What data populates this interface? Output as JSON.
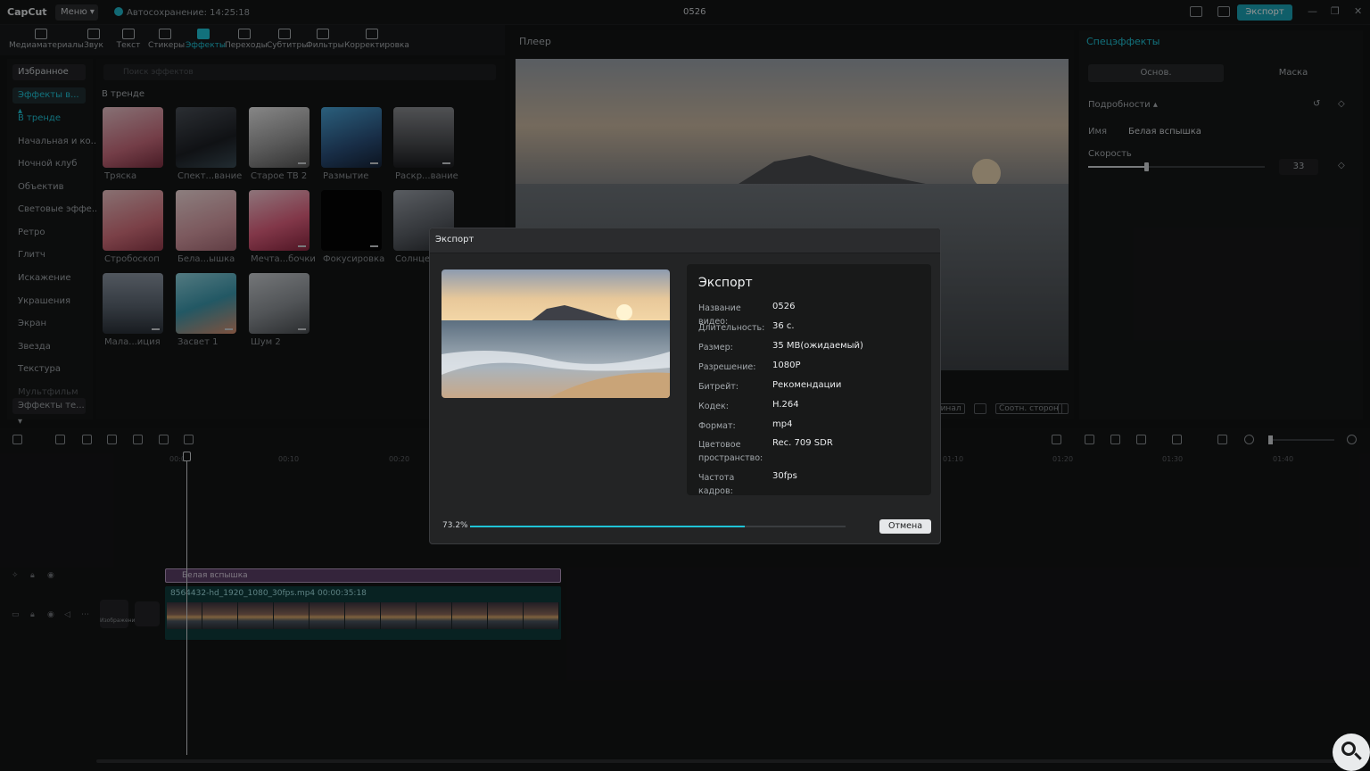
{
  "titlebar": {
    "logo": "CapCut",
    "menu_label": "Меню ▾",
    "autosave": "Автосохранение: 14:25:18",
    "doc_title": "0526",
    "export_label": "Экспорт"
  },
  "toolbar": {
    "tabs": [
      {
        "label": "Медиаматериалы",
        "icon": "media-icon"
      },
      {
        "label": "Звук",
        "icon": "audio-icon"
      },
      {
        "label": "Текст",
        "icon": "text-icon"
      },
      {
        "label": "Стикеры",
        "icon": "sticker-icon"
      },
      {
        "label": "Эффекты",
        "icon": "effects-icon",
        "active": true
      },
      {
        "label": "Переходы",
        "icon": "transition-icon"
      },
      {
        "label": "Субтитры",
        "icon": "subtitles-icon"
      },
      {
        "label": "Фильтры",
        "icon": "filter-icon"
      },
      {
        "label": "Корректировка",
        "icon": "adjust-icon"
      }
    ]
  },
  "categories": {
    "favorites": "Избранное",
    "selected_group": "Эффекты в... ▴",
    "items": [
      "В тренде",
      "Начальная и ко...",
      "Ночной клуб",
      "Объектив",
      "Световые эффе...",
      "Ретро",
      "Глитч",
      "Искажение",
      "Украшения",
      "Экран",
      "Звезда",
      "Текстура",
      "Мультфильм"
    ],
    "bottom_group": "Эффекты те... ▾"
  },
  "effects": {
    "search_placeholder": "Поиск эффектов",
    "section": "В тренде",
    "items": [
      "Тряска",
      "Спект...вание",
      "Старое ТВ 2",
      "Размытие",
      "Раскр...вание",
      "Стробоскоп",
      "Бела...ышка",
      "Мечта...бочки",
      "Фокусировка",
      "Солнце",
      "Мала...иция",
      "Засвет 1",
      "Шум 2"
    ]
  },
  "player": {
    "title": "Плеер",
    "ctrl_original": "...инал",
    "ctrl_ratio": "Соотн. сторон"
  },
  "right_panel": {
    "title": "Спецэффекты",
    "tab_basic": "Основ.",
    "tab_mask": "Маска",
    "details": "Подробности ▴",
    "name_label": "Имя",
    "name_value": "Белая вспышка",
    "speed_label": "Скорость",
    "speed_value": "33",
    "speed_fraction": 0.33
  },
  "timeline": {
    "ruler": [
      "00:00",
      "00:10",
      "00:20",
      "01:10",
      "01:20",
      "01:30",
      "01:40"
    ],
    "fx_clip": "Белая вспышка",
    "video_clip": "8564432-hd_1920_1080_30fps.mp4   00:00:35:18",
    "cover_label": "Изображение"
  },
  "dialog": {
    "title": "Экспорт",
    "heading": "Экспорт",
    "rows": [
      {
        "key": "Название видео:",
        "value": "0526"
      },
      {
        "key": "Длительность:",
        "value": "36 с."
      },
      {
        "key": "Размер:",
        "value": "35 MB(ожидаемый)"
      },
      {
        "key": "Разрешение:",
        "value": "1080P"
      },
      {
        "key": "Битрейт:",
        "value": "Рекомендации"
      },
      {
        "key": "Кодек:",
        "value": "H.264"
      },
      {
        "key": "Формат:",
        "value": "mp4"
      },
      {
        "key": "Цветовое пространство:",
        "value": "Rec. 709 SDR"
      },
      {
        "key": "Частота кадров:",
        "value": "30fps"
      }
    ],
    "progress_label": "73.2%",
    "progress_fraction": 0.732,
    "cancel_label": "Отмена"
  },
  "colors": {
    "accent": "#1fc3d6",
    "fx_clip": "#5b3f66",
    "video_clip": "#0f3b3c"
  }
}
